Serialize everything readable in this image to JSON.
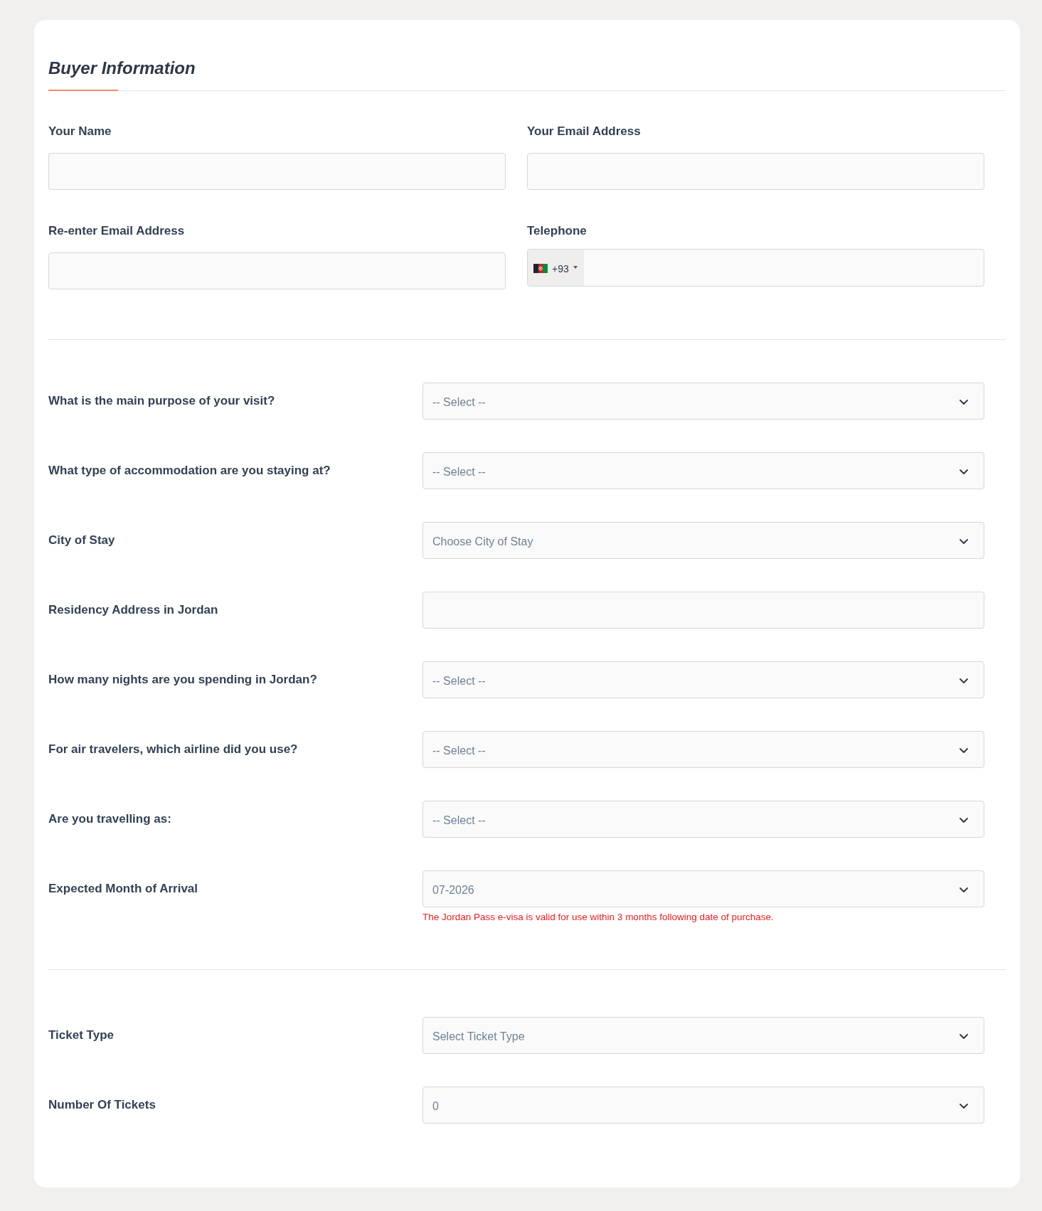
{
  "section_title": "Buyer Information",
  "contact_fields": [
    {
      "label": "Your Name",
      "kind": "text"
    },
    {
      "label": "Your Email Address",
      "kind": "text"
    },
    {
      "label": "Re-enter Email Address",
      "kind": "text"
    },
    {
      "label": "Telephone",
      "kind": "phone",
      "dial_code": "+93"
    }
  ],
  "travel_questions": [
    {
      "label": "What is the main purpose of your visit?",
      "kind": "select",
      "value": "-- Select --"
    },
    {
      "label": "What type of accommodation are you staying at?",
      "kind": "select",
      "value": "-- Select --"
    },
    {
      "label": "City of Stay",
      "kind": "select",
      "value": "Choose City of Stay"
    },
    {
      "label": "Residency Address in Jordan",
      "kind": "text"
    },
    {
      "label": "How many nights are you spending in Jordan?",
      "kind": "select",
      "value": "-- Select --"
    },
    {
      "label": "For air travelers, which airline did you use?",
      "kind": "select",
      "value": "-- Select --"
    },
    {
      "label": "Are you travelling as:",
      "kind": "select",
      "value": "-- Select --"
    },
    {
      "label": "Expected Month of Arrival",
      "kind": "select",
      "value": "07-2026",
      "note": "The Jordan Pass e-visa is valid for use within 3 months following date of purchase."
    }
  ],
  "ticket_questions": [
    {
      "label": "Ticket Type",
      "kind": "select",
      "value": "Select Ticket Type"
    },
    {
      "label": "Number Of Tickets",
      "kind": "select",
      "value": "0"
    }
  ]
}
